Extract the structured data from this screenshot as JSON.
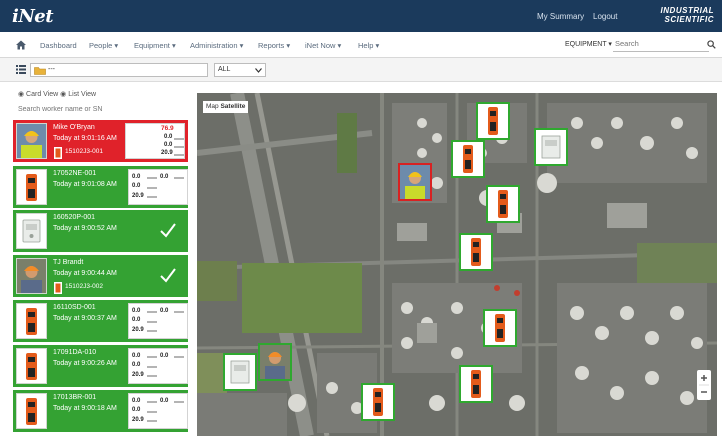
{
  "header": {
    "logo": "iNet",
    "links": [
      "My Summary",
      "Logout"
    ],
    "brand_line1": "INDUSTRIAL",
    "brand_line2": "SCIENTIFIC"
  },
  "nav": {
    "items": [
      "Dashboard",
      "People ▾",
      "Equipment ▾",
      "Administration ▾",
      "Reports ▾",
      "iNet Now ▾",
      "Help ▾"
    ],
    "equipment_select": "EQUIPMENT ▾",
    "search_placeholder": "Search"
  },
  "filter": {
    "group_value": "---",
    "status_value": "ALL"
  },
  "sidebar": {
    "view_toggle": "◉ Card View  ◉ List View",
    "search_placeholder": "Search worker name or SN"
  },
  "cards": [
    {
      "status": "alarm",
      "name": "Mike O'Bryan",
      "time": "Today at 9:01:16 AM",
      "sub": "15102J3-001",
      "readings": [
        "76.9",
        "0.0",
        "0.0",
        "20.9"
      ],
      "check": false
    },
    {
      "status": "ok",
      "name": "17052NE-001",
      "time": "Today at 9:01:08 AM",
      "sub": "",
      "readings": [
        "0.0",
        "0.0",
        "0.0",
        "20.9"
      ],
      "check": false
    },
    {
      "status": "ok",
      "name": "160520P-001",
      "time": "Today at 9:00:52 AM",
      "sub": "",
      "readings": [],
      "check": true
    },
    {
      "status": "ok",
      "name": "TJ Brandt",
      "time": "Today at 9:00:44 AM",
      "sub": "15102J3-002",
      "readings": [],
      "check": true
    },
    {
      "status": "ok",
      "name": "16110SD-001",
      "time": "Today at 9:00:37 AM",
      "sub": "",
      "readings": [
        "0.0",
        "0.0",
        "0.0",
        "20.9"
      ],
      "check": false
    },
    {
      "status": "ok",
      "name": "17091DA-010",
      "time": "Today at 9:00:26 AM",
      "sub": "",
      "readings": [
        "0.0",
        "0.0",
        "0.0",
        "20.9"
      ],
      "check": false
    },
    {
      "status": "ok",
      "name": "17013BR-001",
      "time": "Today at 9:00:18 AM",
      "sub": "",
      "readings": [
        "0.0",
        "0.0",
        "0.0",
        "20.9"
      ],
      "check": false
    }
  ],
  "map": {
    "tab_map": "Map",
    "tab_satellite": "Satellite"
  },
  "colors": {
    "header": "#1b3a5c",
    "card_ok": "#34a233",
    "card_alarm": "#e0222a",
    "marker_ok": "#2fa82f",
    "marker_alarm": "#d82222"
  }
}
